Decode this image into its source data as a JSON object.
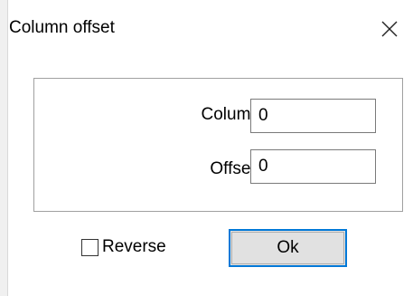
{
  "window": {
    "title": "Column offset",
    "close_icon": "close-icon"
  },
  "form": {
    "column_label": "Column",
    "column_value": "0",
    "offset_label": "Offset:",
    "offset_value": "0"
  },
  "options": {
    "reverse_label": "Reverse",
    "reverse_checked": false
  },
  "actions": {
    "ok_label": "Ok"
  },
  "colors": {
    "accent": "#0078d7",
    "button_face": "#e1e1e1",
    "border": "#a0a0a0"
  }
}
